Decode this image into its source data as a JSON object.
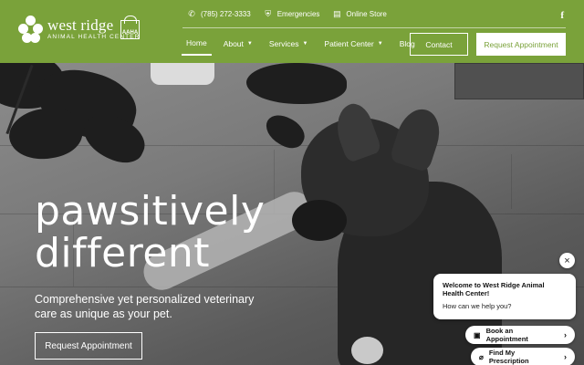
{
  "brand": {
    "name": "west ridge",
    "subtitle": "ANIMAL HEALTH CENTER",
    "badge": "AAHA",
    "primary_color": "#7aa23a"
  },
  "topbar": {
    "phone": "(785) 272-3333",
    "emergencies": "Emergencies",
    "store": "Online Store",
    "social": "f"
  },
  "nav": {
    "items": [
      {
        "label": "Home",
        "active": true
      },
      {
        "label": "About",
        "dropdown": true
      },
      {
        "label": "Services",
        "dropdown": true
      },
      {
        "label": "Patient Center",
        "dropdown": true
      },
      {
        "label": "Blog"
      }
    ],
    "contact_label": "Contact",
    "request_label": "Request Appointment"
  },
  "hero": {
    "headline_line1": "pawsitively",
    "headline_line2": "different",
    "subtext": "Comprehensive yet personalized veterinary care as unique as your pet.",
    "cta_label": "Request Appointment"
  },
  "chat": {
    "close": "×",
    "title": "Welcome to West Ridge Animal Health Center!",
    "message": "How can we help you?",
    "actions": [
      {
        "label": "Book an Appointment",
        "icon": "calendar-icon"
      },
      {
        "label": "Find My Prescription",
        "icon": "pill-icon"
      }
    ]
  }
}
